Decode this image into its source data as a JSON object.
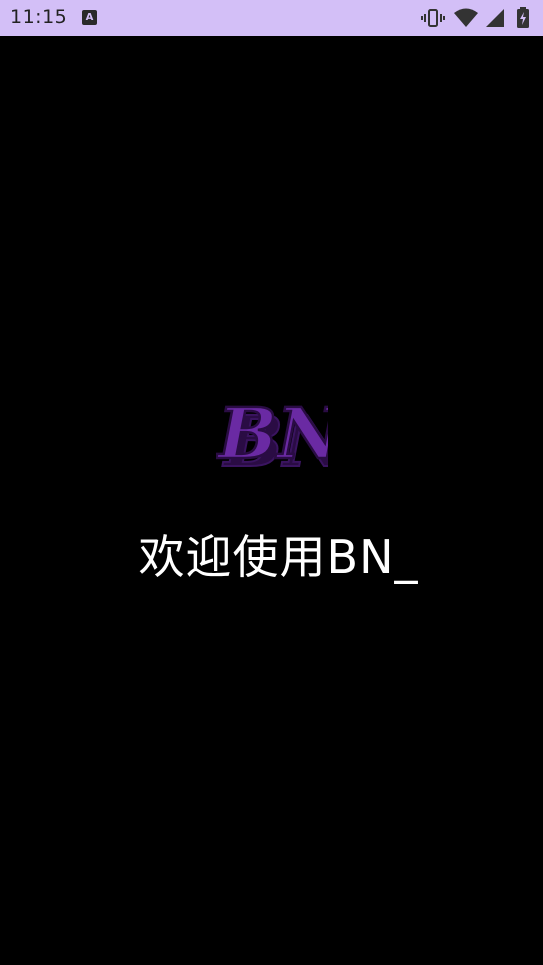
{
  "status_bar": {
    "time": "11:15",
    "notification_letter": "A",
    "icons": [
      "vibrate-icon",
      "wifi-icon",
      "signal-icon",
      "battery-charging-icon"
    ],
    "background_color": "#d3bff7"
  },
  "splash": {
    "background_color": "#000000",
    "logo_text": "BN",
    "logo_color": "#6a2aa3",
    "welcome_text": "欢迎使用BN_"
  }
}
